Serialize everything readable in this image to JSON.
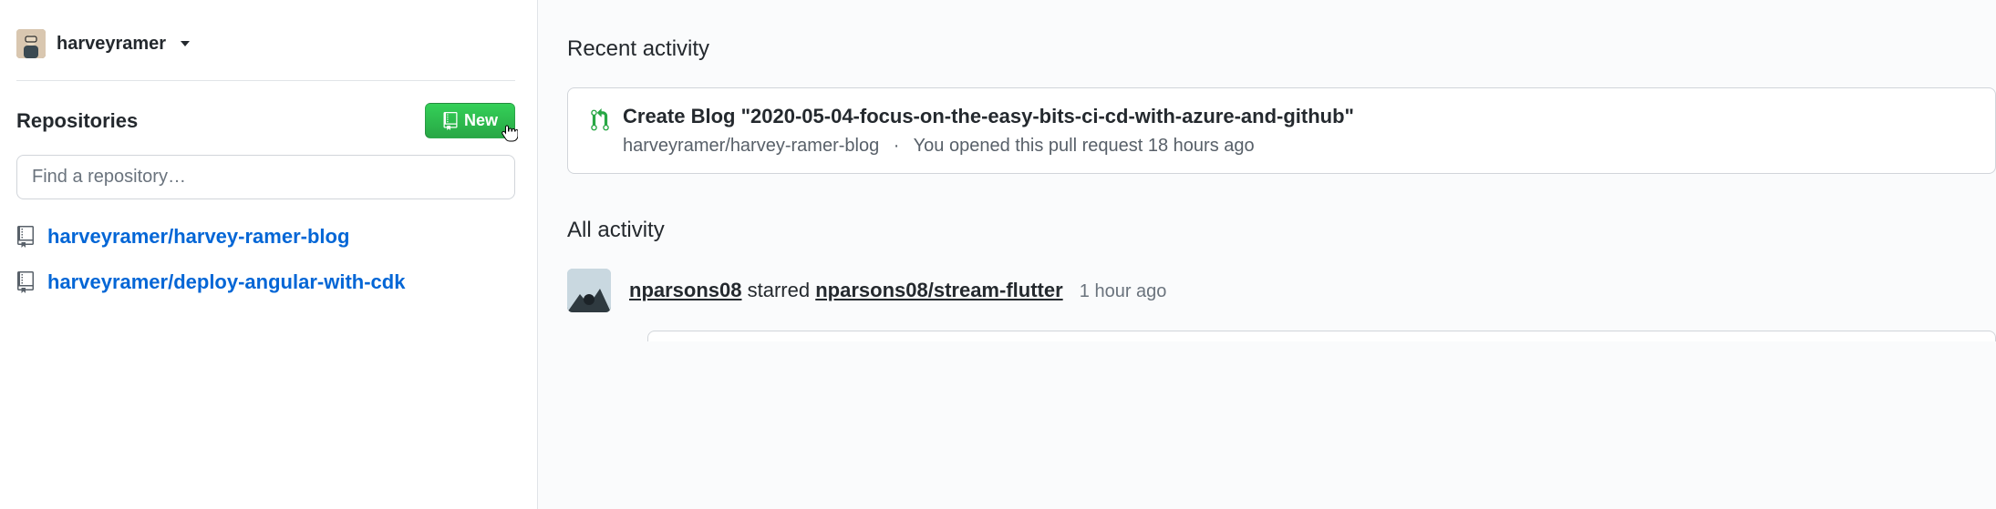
{
  "sidebar": {
    "username": "harveyramer",
    "repos_heading": "Repositories",
    "new_button_label": "New",
    "search_placeholder": "Find a repository…",
    "repos": [
      {
        "name": "harveyramer/harvey-ramer-blog"
      },
      {
        "name": "harveyramer/deploy-angular-with-cdk"
      }
    ]
  },
  "recent": {
    "heading": "Recent activity",
    "item": {
      "title": "Create Blog \"2020-05-04-focus-on-the-easy-bits-ci-cd-with-azure-and-github\"",
      "repo": "harveyramer/harvey-ramer-blog",
      "meta": "You opened this pull request 18 hours ago"
    }
  },
  "all_activity": {
    "heading": "All activity",
    "item": {
      "actor": "nparsons08",
      "action": "starred",
      "repo": "nparsons08/stream-flutter",
      "time": "1 hour ago"
    }
  }
}
